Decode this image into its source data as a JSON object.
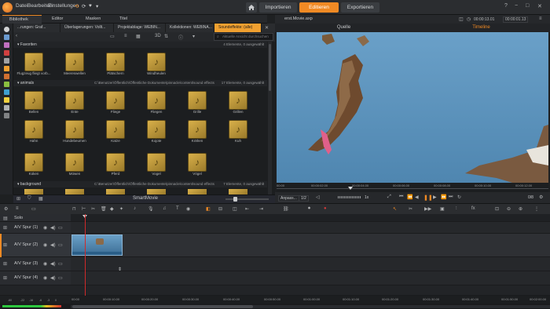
{
  "menu": {
    "items": [
      "Datei",
      "Bearbeiten",
      "Einstellungen"
    ]
  },
  "modes": {
    "import": "Importieren",
    "edit": "Editieren",
    "export": "Exportieren"
  },
  "window_controls": {
    "help": "?",
    "minimize": "−",
    "maximize": "□",
    "close": "✕"
  },
  "library_tabs": [
    "Bibliothek",
    "Editor",
    "Masken",
    "Titel"
  ],
  "breadcrumbs": [
    "...rungen: Graf...",
    "Überlagerungen: Vollt...",
    "Projektablage: WEBIN...",
    "Kollektionen: WEBINA...",
    "Soundeffekte: (alle)"
  ],
  "view": {
    "zoom_label": "3D"
  },
  "search": {
    "placeholder": "Aktuelle Ansicht durchsuchen"
  },
  "sections": [
    {
      "name": "Favoriten",
      "path": "",
      "info": "4 Elemente, 0 ausgewählt",
      "items": [
        "Flugzeug fliegt vorb...",
        "Meereswellen",
        "Plätschern",
        "Windheulen"
      ]
    },
    {
      "name": "animals",
      "path": "C:\\Benutzer\\Öffentlich\\Öffentliche Dokumente\\pinnacle\\content\\sound effects",
      "info": "17 Elemente, 0 ausgewählt",
      "items": [
        "Bellen",
        "Ente",
        "Fliege",
        "Fliegen",
        "Grille",
        "Grillen",
        "Hahn",
        "Hundebeumen",
        "Katze",
        "Kojote",
        "Krähen",
        "Kuh",
        "Küken",
        "Möwen",
        "Pferd",
        "Vogel",
        "Vögel"
      ]
    },
    {
      "name": "background",
      "path": "C:\\Benutzer\\Öffentlich\\Öffentliche Dokumente\\pinnacle\\content\\sound effects",
      "info": "7 Elemente, 0 ausgewählt",
      "items": []
    }
  ],
  "smartmovie": "SmartMovie",
  "player": {
    "file": "erst.Movie.axp",
    "timecode1": "00:00:13.01",
    "timecode2": "00:00:01.13",
    "tabs": [
      "Quelle",
      "Timeline"
    ],
    "ruler": [
      "00:00",
      "00:00:02.00",
      "00:00:04.00",
      "00:00:06.00",
      "00:00:08.00",
      "00:00:10.00",
      "00:00:12.00"
    ],
    "fit": "Anpass...",
    "ratio": "1/2",
    "speed": "1x",
    "counter": "0/8"
  },
  "timeline": {
    "solo": "Solo",
    "tracks": [
      "A/V Spur (1)",
      "A/V Spur (2)",
      "A/V Spur (3)",
      "A/V Spur (4)"
    ],
    "ruler": [
      "00:00",
      "00:00:10.00",
      "00:00:20.00",
      "00:00:30.00",
      "00:00:40.00",
      "00:00:50.00",
      "00:01:00.00",
      "00:01:10.00",
      "00:01:20.00",
      "00:01:30.00",
      "00:01:40.00",
      "00:01:50.00",
      "00:02:00.00"
    ],
    "meter_labels": [
      "-60",
      "-22",
      "-16",
      "-6",
      "-3",
      "0"
    ]
  },
  "colors": {
    "accent": "#f08a24",
    "sea": "#5d93bb",
    "tile": "#c9a23e"
  }
}
